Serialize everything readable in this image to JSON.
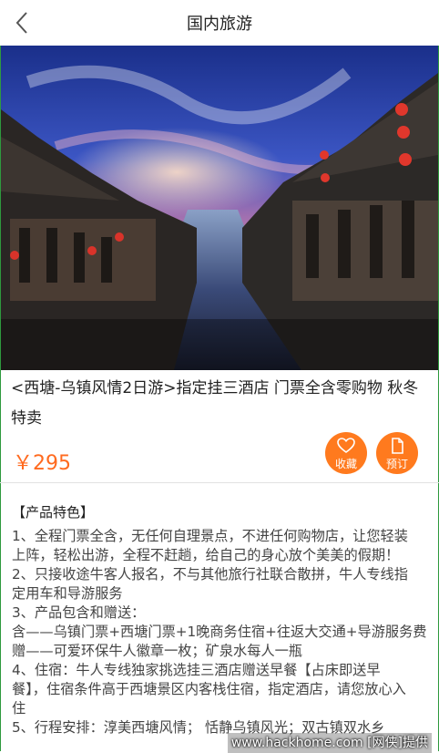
{
  "header": {
    "title": "国内旅游",
    "back_icon": "chevron-left-icon"
  },
  "product": {
    "title_line1": "<西塘-乌镇风情2日游>指定挂三酒店 门票全含零购物 秋冬",
    "title_line2": "特卖",
    "price": "￥295"
  },
  "actions": {
    "favorite_label": "收藏",
    "favorite_icon": "heart-icon",
    "book_label": "预订",
    "book_icon": "document-icon"
  },
  "details": {
    "section_title": "【产品特色】",
    "lines": [
      "1、全程门票全含，无任何自理景点，不进任何购物店，让您轻装",
      "上阵，轻松出游，全程不赶趟，给自己的身心放个美美的假期！",
      "2、只接收途牛客人报名，不与其他旅行社联合散拼，牛人专线指",
      "定用车和导游服务",
      "3、产品包含和赠送：",
      "含——乌镇门票+西塘门票+1晚商务住宿+往返大交通+导游服务费",
      "赠——可爱环保牛人徽章一枚；矿泉水每人一瓶",
      "4、住宿：牛人专线独家挑选挂三酒店赠送早餐【占床即送早",
      "餐】，住宿条件高于西塘景区内客栈住宿，指定酒店，请您放心入",
      "住",
      "5、行程安排：淳美西塘风情； 恬静乌镇风光；双古镇双水乡"
    ]
  },
  "watermark": "www.hackhome.com [网侠]提供",
  "colors": {
    "accent": "#ff7a1e",
    "price": "#ff6a1f",
    "frame": "#2e9a3e"
  }
}
